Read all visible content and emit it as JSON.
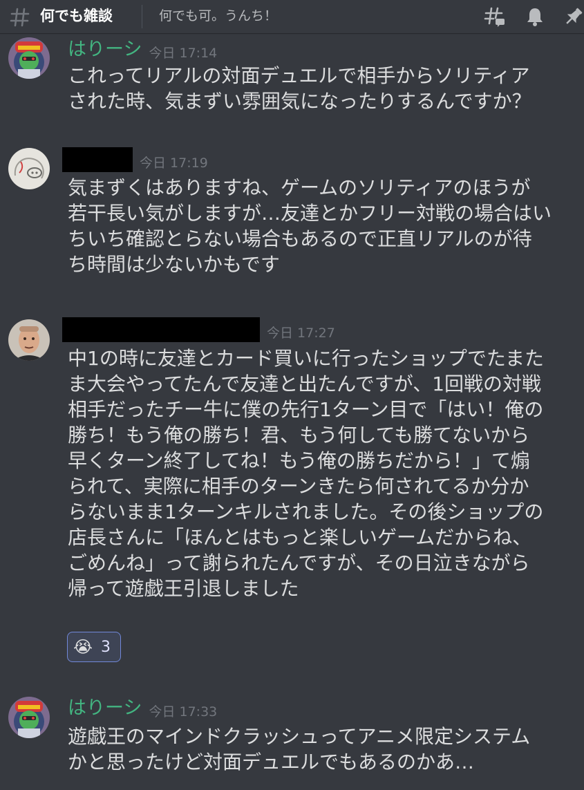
{
  "header": {
    "channel_name": "何でも雑談",
    "topic": "何でも可。うんち！"
  },
  "messages": [
    {
      "username": "はりーシ",
      "timestamp": "今日 17:14",
      "text": "これってリアルの対面デュエルで相手からソリティア\nされた時、気まずい雰囲気になったりするんですか？"
    },
    {
      "username": "",
      "timestamp": "今日 17:19",
      "text": "気まずくはありますね、ゲームのソリティアのほうが\n若干長い気がしますが…友達とかフリー対戦の場合はい\nちいち確認とらない場合もあるので正直リアルのが待\nち時間は少ないかもです"
    },
    {
      "username": "",
      "timestamp": "今日 17:27",
      "text": "中1の時に友達とカード買いに行ったショップでたまた\nま大会やってたんで友達と出たんですが、1回戦の対戦\n相手だったチー牛に僕の先行1ターン目で「はい！俺の\n勝ち！もう俺の勝ち！君、もう何しても勝てないから\n早くターン終了してね！もう俺の勝ちだから！」て煽\nられて、実際に相手のターンきたら何されてるか分か\nらないまま1ターンキルされました。その後ショップの\n店長さんに「ほんとはもっと楽しいゲームだからね、\nごめんね」って謝られたんですが、その日泣きながら\n帰って遊戯王引退しました",
      "reaction": {
        "emoji": "😭",
        "count": "3"
      }
    },
    {
      "username": "はりーシ",
      "timestamp": "今日 17:33",
      "text": "遊戯王のマインドクラッシュってアニメ限定システム\nかと思ったけど対面デュエルでもあるのかあ…"
    }
  ],
  "icons": {
    "hash": "hash-icon",
    "threads": "threads-icon",
    "notification": "bell-icon",
    "pin": "pin-icon"
  },
  "colors": {
    "background": "#36393f",
    "username_green": "#43b581",
    "timestamp": "#72767d",
    "reaction_border": "#7289da"
  }
}
